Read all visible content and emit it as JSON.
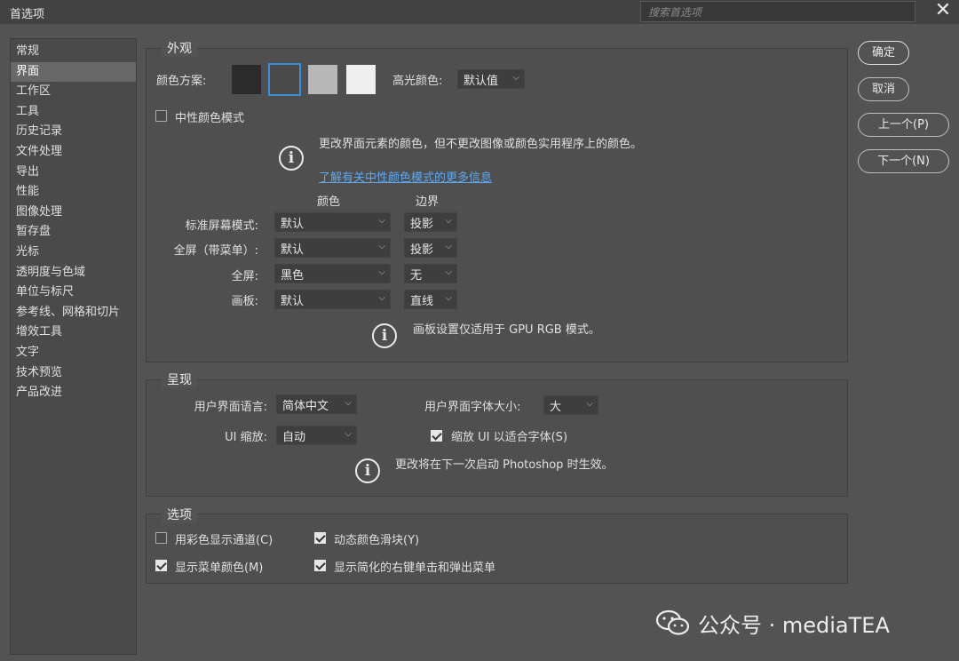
{
  "window": {
    "title": "首选项",
    "search_placeholder": "搜索首选项",
    "close_glyph": "✕"
  },
  "sidebar": {
    "items": [
      "常规",
      "界面",
      "工作区",
      "工具",
      "历史记录",
      "文件处理",
      "导出",
      "性能",
      "图像处理",
      "暂存盘",
      "光标",
      "透明度与色域",
      "单位与标尺",
      "参考线、网格和切片",
      "增效工具",
      "文字",
      "技术预览",
      "产品改进"
    ],
    "active_index": 1
  },
  "appearance": {
    "title": "外观",
    "color_scheme_label": "颜色方案:",
    "swatches": [
      "#2b2b2b",
      "#4a4a4a",
      "#b8b8b8",
      "#efefef"
    ],
    "selected_swatch": 1,
    "highlight_label": "高光颜色:",
    "highlight_value": "默认值",
    "neutral_label": "中性颜色模式",
    "neutral_checked": false,
    "info_text": "更改界面元素的颜色，但不更改图像或颜色实用程序上的颜色。",
    "learn_more": "了解有关中性颜色模式的更多信息",
    "col_color": "颜色",
    "col_border": "边界",
    "rows": [
      {
        "label": "标准屏幕模式:",
        "color": "默认",
        "border": "投影"
      },
      {
        "label": "全屏（带菜单）:",
        "color": "默认",
        "border": "投影"
      },
      {
        "label": "全屏:",
        "color": "黑色",
        "border": "无"
      },
      {
        "label": "画板:",
        "color": "默认",
        "border": "直线"
      }
    ],
    "artboard_note": "画板设置仅适用于 GPU RGB 模式。",
    "info_icon": "info-icon"
  },
  "presentation": {
    "title": "呈现",
    "lang_label": "用户界面语言:",
    "lang_value": "简体中文",
    "font_size_label": "用户界面字体大小:",
    "font_size_value": "大",
    "ui_scale_label": "UI 缩放:",
    "ui_scale_value": "自动",
    "scale_to_font_label": "缩放 UI 以适合字体(S)",
    "scale_to_font_checked": true,
    "restart_note": "更改将在下一次启动 Photoshop 时生效。"
  },
  "options": {
    "title": "选项",
    "color_channels_label": "用彩色显示通道(C)",
    "color_channels_checked": false,
    "dynamic_sliders_label": "动态颜色滑块(Y)",
    "dynamic_sliders_checked": true,
    "menu_colors_label": "显示菜单颜色(M)",
    "menu_colors_checked": true,
    "simplified_menus_label": "显示简化的右键单击和弹出菜单",
    "simplified_menus_checked": true
  },
  "buttons": {
    "ok": "确定",
    "cancel": "取消",
    "prev": "上一个(P)",
    "next": "下一个(N)"
  },
  "watermark": {
    "text": "公众号 · mediaTEA",
    "icon": "wechat-icon"
  },
  "chevron": "⌵"
}
